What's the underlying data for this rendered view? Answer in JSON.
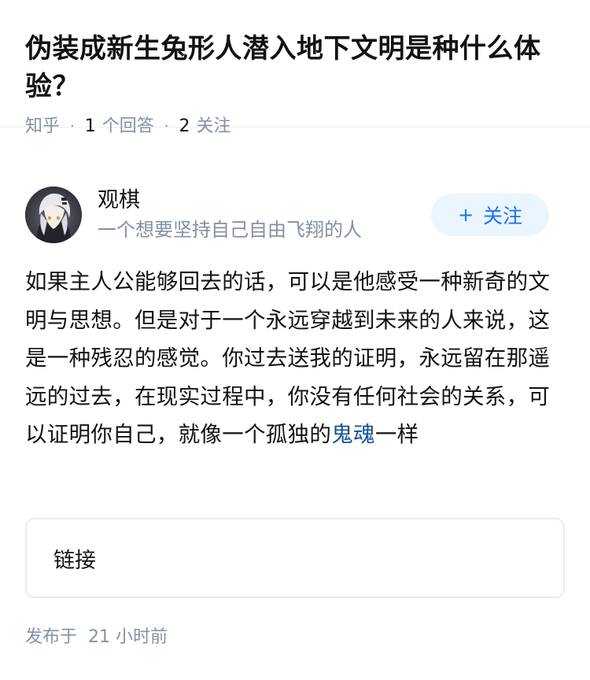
{
  "question": {
    "title": "伪装成新生兔形人潜入地下文明是种什么体验？",
    "source": "知乎",
    "answers_count": "1",
    "answers_label": "个回答",
    "follows_count": "2",
    "follows_label": "关注"
  },
  "author": {
    "name": "观棋",
    "headline": "一个想要坚持自己自由飞翔的人",
    "follow_label": "关注",
    "follow_icon": "plus-icon"
  },
  "answer": {
    "text_before": "如果主人公能够回去的话，可以是他感受一种新奇的文明与思想。但是对于一个永远穿越到未来的人来说，这是一种残忍的感觉。你过去送我的证明，永远留在那遥远的过去，在现实过程中，你没有任何社会的关系，可以证明你自己，就像一个孤独的",
    "link_text": "鬼魂",
    "text_after": "一样"
  },
  "link_card": {
    "label": "链接"
  },
  "footer": {
    "published_label": "发布于",
    "published_time": "21 小时前"
  },
  "colors": {
    "accent": "#1772f6",
    "follow_bg": "#ebf5fd",
    "meta_gray": "#8590a6",
    "link_blue": "#175199"
  }
}
